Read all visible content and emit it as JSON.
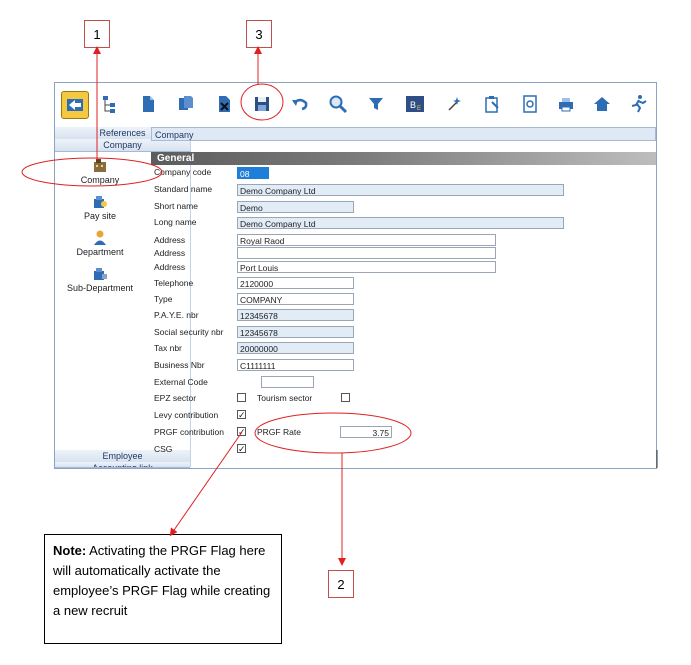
{
  "callouts": {
    "c1": "1",
    "c2": "2",
    "c3": "3"
  },
  "note": {
    "bold": "Note:",
    "text": " Activating the PRGF Flag here will automatically activate the employee’s PRGF Flag while creating a new recruit"
  },
  "toolbar": {
    "icons": [
      "back-icon",
      "hierarchy-icon",
      "new-document-icon",
      "copy-document-icon",
      "delete-document-icon",
      "save-icon",
      "undo-icon",
      "search-icon",
      "filter-icon",
      "report-icon",
      "wizard-icon",
      "clipboard-icon",
      "preview-icon",
      "print-icon",
      "home-icon",
      "exit-icon"
    ]
  },
  "sidebar": {
    "header_references": "References",
    "header_company": "Company",
    "items": [
      {
        "label": "Company",
        "icon": "company-icon"
      },
      {
        "label": "Pay site",
        "icon": "pay-site-icon"
      },
      {
        "label": "Department",
        "icon": "department-icon"
      },
      {
        "label": "Sub-Department",
        "icon": "sub-department-icon"
      }
    ],
    "footer_employee": "Employee",
    "footer_accounting": "Accounting link"
  },
  "content": {
    "title": "Company",
    "section": "General"
  },
  "form": {
    "company_code": {
      "label": "Company code",
      "value": "08"
    },
    "standard_name": {
      "label": "Standard name",
      "value": "Demo Company Ltd"
    },
    "short_name": {
      "label": "Short name",
      "value": "Demo"
    },
    "long_name": {
      "label": "Long name",
      "value": "Demo Company Ltd"
    },
    "address1": {
      "label": "Address",
      "value": "Royal Raod"
    },
    "address2": {
      "label": "Address",
      "value": ""
    },
    "address3": {
      "label": "Address",
      "value": "Port Louis"
    },
    "telephone": {
      "label": "Telephone",
      "value": "2120000"
    },
    "type": {
      "label": "Type",
      "value": "COMPANY"
    },
    "paye": {
      "label": "P.A.Y.E. nbr",
      "value": "12345678"
    },
    "social": {
      "label": "Social security nbr",
      "value": "12345678"
    },
    "tax": {
      "label": "Tax nbr",
      "value": "20000000"
    },
    "business": {
      "label": "Business Nbr",
      "value": "C1111111"
    },
    "external": {
      "label": "External Code",
      "value": ""
    },
    "epz": {
      "label": "EPZ sector",
      "checked": false
    },
    "tourism": {
      "label": "Tourism sector",
      "checked": false
    },
    "levy": {
      "label": "Levy contribution",
      "checked": true
    },
    "prgf": {
      "label": "PRGF contribution",
      "checked": true
    },
    "prgf_rate": {
      "label": "PRGF Rate",
      "value": "3.75"
    },
    "csg": {
      "label": "CSG",
      "checked": true
    }
  },
  "colors": {
    "annotation": "#e02020",
    "accent": "#1f7fd8"
  }
}
